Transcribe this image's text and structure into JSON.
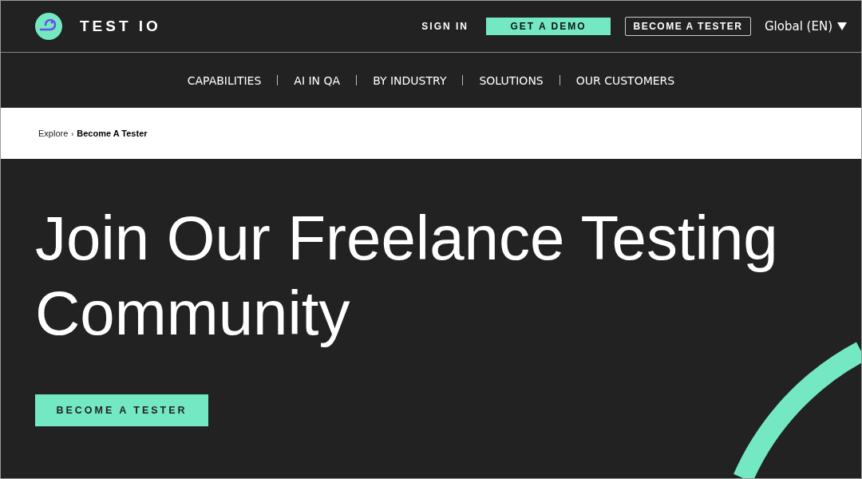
{
  "header": {
    "logo_text": "TEST IO",
    "sign_in": "SIGN IN",
    "demo_button": "GET A DEMO",
    "tester_button": "BECOME A TESTER",
    "language": "Global (EN)"
  },
  "nav": {
    "items": [
      {
        "label": "CAPABILITIES"
      },
      {
        "label": "AI IN QA"
      },
      {
        "label": "BY INDUSTRY"
      },
      {
        "label": "SOLUTIONS"
      },
      {
        "label": "OUR CUSTOMERS"
      }
    ]
  },
  "breadcrumb": {
    "items": [
      {
        "label": "Explore",
        "current": false
      },
      {
        "label": "Become A Tester",
        "current": true
      }
    ],
    "separator": "›"
  },
  "hero": {
    "title": "Join Our Freelance Testing Community",
    "button": "BECOME A TESTER"
  }
}
